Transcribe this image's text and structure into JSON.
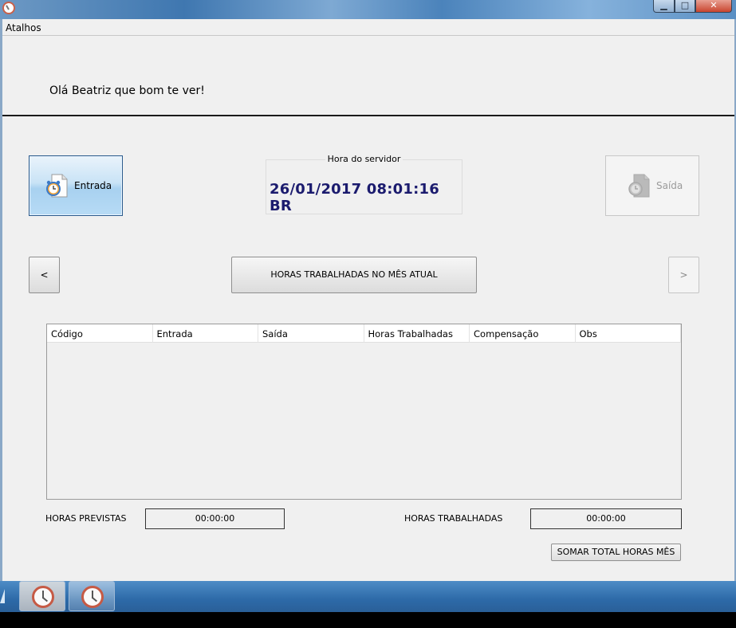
{
  "menu": {
    "atalhos": "Atalhos"
  },
  "greeting": "Olá Beatriz que bom te ver!",
  "entrada": {
    "label": "Entrada",
    "icon": "alarm-clock-document-icon"
  },
  "server": {
    "caption": "Hora do servidor",
    "time": "26/01/2017 08:01:16 BR"
  },
  "saida": {
    "label": "Saída",
    "icon": "clock-document-icon",
    "enabled": false
  },
  "nav": {
    "prev": "<",
    "month": "HORAS TRABALHADAS NO MÊS ATUAL",
    "next": ">"
  },
  "grid": {
    "columns": [
      "Código",
      "Entrada",
      "Saída",
      "Horas Trabalhadas",
      "Compensação",
      "Obs"
    ],
    "rows": []
  },
  "totals": {
    "previstas_label": "HORAS PREVISTAS",
    "previstas_value": "00:00:00",
    "trabalhadas_label": "HORAS TRABALHADAS",
    "trabalhadas_value": "00:00:00",
    "somar_label": "SOMAR TOTAL HORAS MÊS"
  },
  "window_controls": {
    "minimize": "▁",
    "maximize": "□",
    "close": "✕"
  },
  "colors": {
    "server_time": "#1b1b6e",
    "entrada_active": "#a8d1f0",
    "taskbar": "#2d6aa8"
  }
}
